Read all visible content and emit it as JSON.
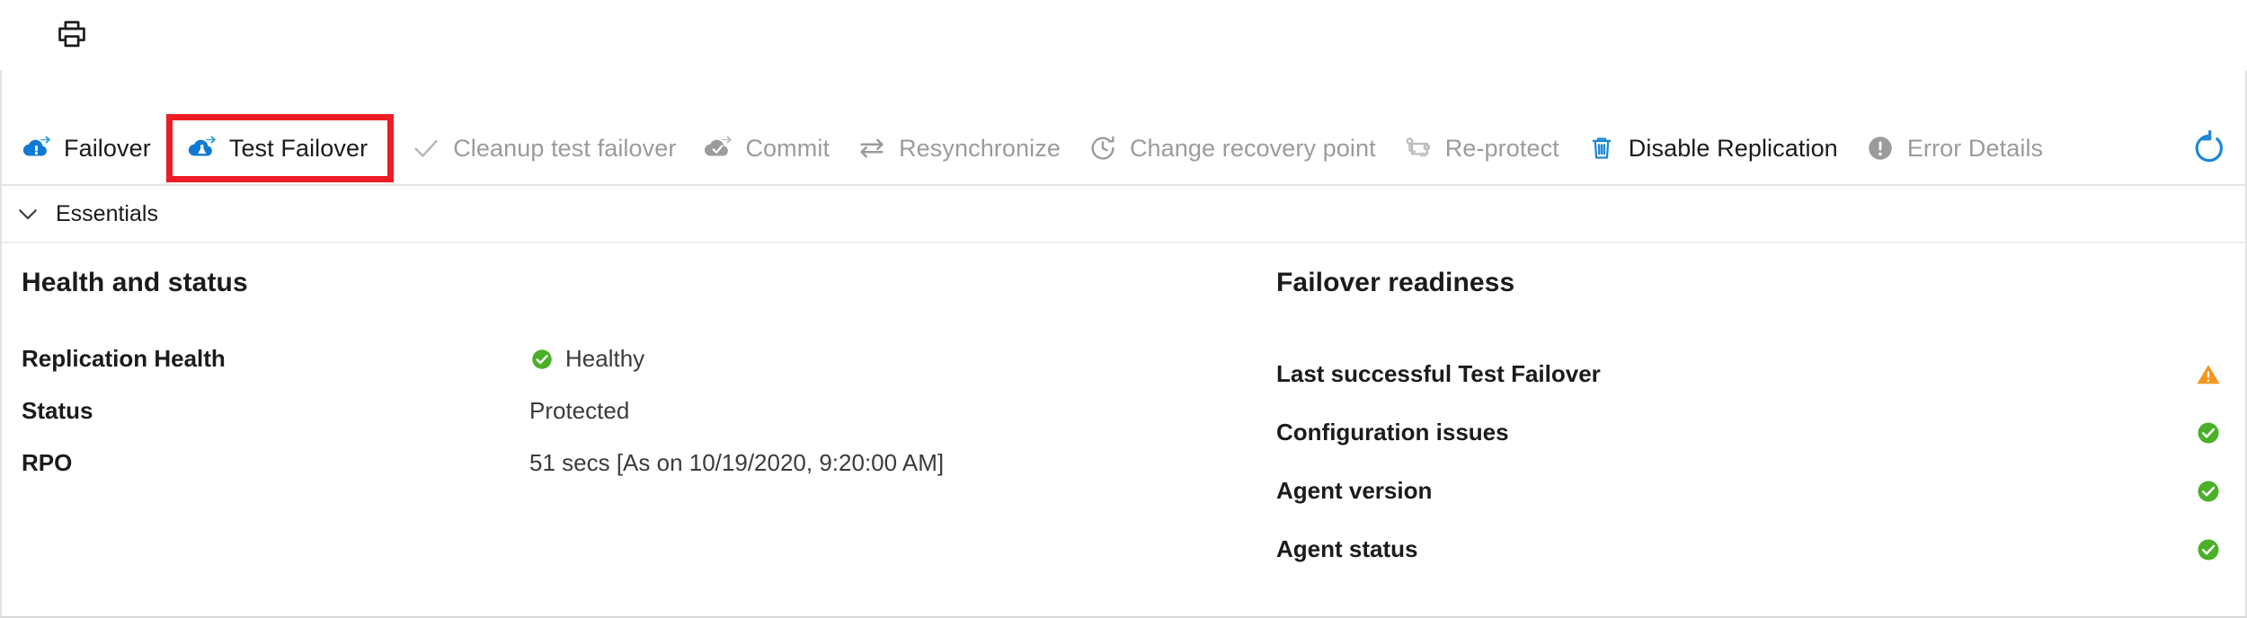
{
  "window": {
    "background": "#ffffff",
    "border_color": "#d6d6d6"
  },
  "top_strip": {
    "clipped_icon": "partial-blue-icon",
    "print_button": {
      "name": "print-icon",
      "tooltip": "Print"
    }
  },
  "toolbar": {
    "commands": [
      {
        "label": "Failover",
        "icon": "cloud-failover-icon",
        "enabled": true,
        "highlighted": false
      },
      {
        "label": "Test Failover",
        "icon": "cloud-flask-icon",
        "enabled": true,
        "highlighted": true
      },
      {
        "label": "Cleanup test failover",
        "icon": "checkmark-icon",
        "enabled": false,
        "highlighted": false
      },
      {
        "label": "Commit",
        "icon": "cloud-check-icon",
        "enabled": false,
        "highlighted": false
      },
      {
        "label": "Resynchronize",
        "icon": "two-way-arrows-icon",
        "enabled": false,
        "highlighted": false
      },
      {
        "label": "Change recovery point",
        "icon": "clock-rewind-icon",
        "enabled": false,
        "highlighted": false
      },
      {
        "label": "Re-protect",
        "icon": "reprotect-icon",
        "enabled": false,
        "highlighted": false
      },
      {
        "label": "Disable Replication",
        "icon": "trash-icon",
        "enabled": true,
        "highlighted": false
      },
      {
        "label": "Error Details",
        "icon": "error-circle-icon",
        "enabled": false,
        "highlighted": false
      }
    ],
    "refresh": {
      "label": "Refresh",
      "icon": "refresh-icon"
    },
    "highlight_color": "#ed1c24",
    "enabled_text_color": "#1b1b1b",
    "disabled_text_color": "#9b9b9b",
    "accent_color": "#0078d4"
  },
  "essentials": {
    "label": "Essentials",
    "chevron": "chevron-down-icon",
    "expanded": true
  },
  "health_and_status": {
    "title": "Health and status",
    "rows": [
      {
        "label": "Replication Health",
        "value": "Healthy",
        "status_icon": "green-check-circle-icon"
      },
      {
        "label": "Status",
        "value": "Protected",
        "status_icon": "none"
      },
      {
        "label": "RPO",
        "value": "51 secs [As on 10/19/2020, 9:20:00 AM]",
        "status_icon": "none"
      }
    ]
  },
  "failover_readiness": {
    "title": "Failover readiness",
    "rows": [
      {
        "label": "Last successful Test Failover",
        "status_icon": "orange-warning-triangle-icon"
      },
      {
        "label": "Configuration issues",
        "status_icon": "green-check-circle-icon"
      },
      {
        "label": "Agent version",
        "status_icon": "green-check-circle-icon"
      },
      {
        "label": "Agent status",
        "status_icon": "green-check-circle-icon"
      }
    ]
  },
  "colors": {
    "healthy_green": "#49b028",
    "warning_orange": "#f7941d",
    "azure_blue": "#0078d4",
    "disabled_grey": "#9b9b9b",
    "highlight_red": "#ed1c24"
  }
}
